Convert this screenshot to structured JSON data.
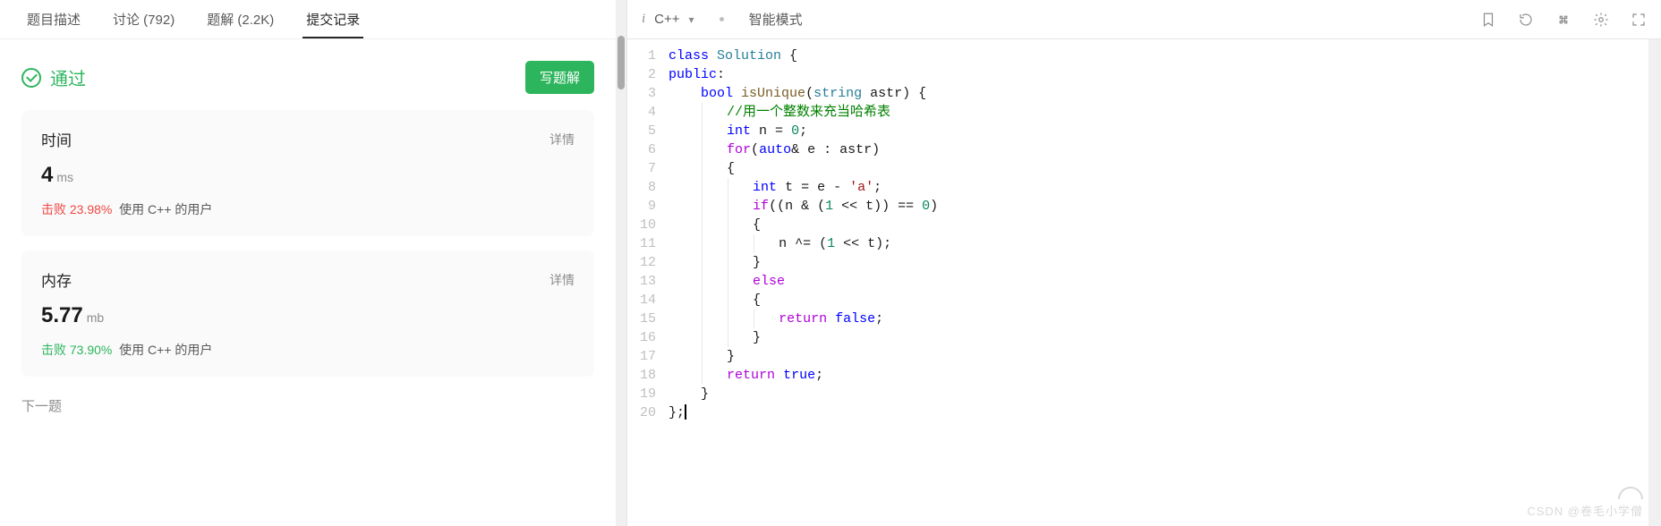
{
  "tabs": {
    "description": "题目描述",
    "discussion": "讨论 (792)",
    "solutions": "题解 (2.2K)",
    "submissions": "提交记录"
  },
  "status": {
    "passed": "通过",
    "write_solution": "写题解"
  },
  "time_card": {
    "title": "时间",
    "detail": "详情",
    "value": "4",
    "unit": "ms",
    "beat_label": "击败",
    "beat_pct": "23.98%",
    "beat_tail": "使用 C++ 的用户"
  },
  "mem_card": {
    "title": "内存",
    "detail": "详情",
    "value": "5.77",
    "unit": "mb",
    "beat_label": "击败",
    "beat_pct": "73.90%",
    "beat_tail": "使用 C++ 的用户"
  },
  "next_q": "下一题",
  "editor": {
    "lang": "C++",
    "mode": "智能模式"
  },
  "code": {
    "l1a": "class",
    "l1b": "Solution",
    "l1c": " {",
    "l2a": "public",
    "l2b": ":",
    "l3a": "bool",
    "l3b": "isUnique",
    "l3c": "(",
    "l3d": "string",
    "l3e": " astr) {",
    "l4a": "//用一个整数来充当哈希表",
    "l5a": "int",
    "l5b": " n = ",
    "l5c": "0",
    "l5d": ";",
    "l6a": "for",
    "l6b": "(",
    "l6c": "auto",
    "l6d": "& e : astr)",
    "l7a": "{",
    "l8a": "int",
    "l8b": " t = e - ",
    "l8c": "'a'",
    "l8d": ";",
    "l9a": "if",
    "l9b": "((n & (",
    "l9c": "1",
    "l9d": " << t)) == ",
    "l9e": "0",
    "l9f": ")",
    "l10a": "{",
    "l11a": "n ^= (",
    "l11b": "1",
    "l11c": " << t);",
    "l12a": "}",
    "l13a": "else",
    "l14a": "{",
    "l15a": "return",
    "l15b": "false",
    "l15c": ";",
    "l16a": "}",
    "l17a": "}",
    "l18a": "return",
    "l18b": "true",
    "l18c": ";",
    "l19a": "}",
    "l20a": "};"
  },
  "line_numbers": [
    "1",
    "2",
    "3",
    "4",
    "5",
    "6",
    "7",
    "8",
    "9",
    "10",
    "11",
    "12",
    "13",
    "14",
    "15",
    "16",
    "17",
    "18",
    "19",
    "20"
  ],
  "watermark": "CSDN @卷毛小学僧"
}
